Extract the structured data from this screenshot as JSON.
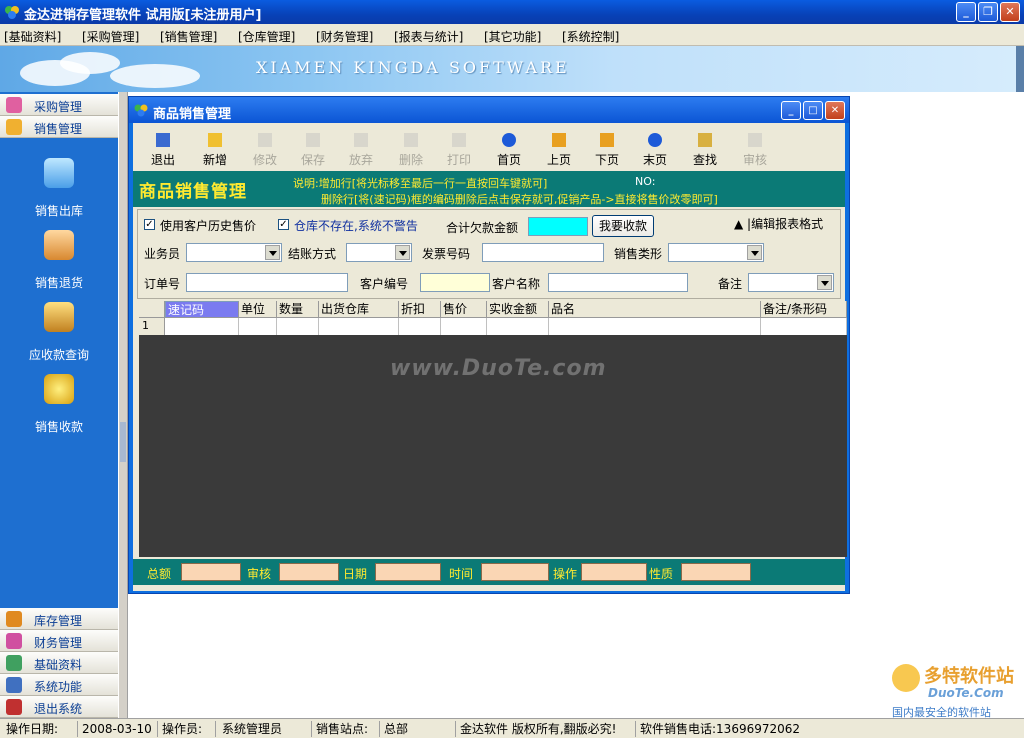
{
  "app": {
    "title": "金达进销存管理软件  试用版[未注册用户]"
  },
  "menu": [
    "[基础资料]",
    "[采购管理]",
    "[销售管理]",
    "[仓库管理]",
    "[财务管理]",
    "[报表与统计]",
    "[其它功能]",
    "[系统控制]"
  ],
  "banner": {
    "slogan": "XIAMEN KINGDA SOFTWARE"
  },
  "leftnav": {
    "top_heads": [
      "采购管理",
      "销售管理"
    ],
    "items": [
      "销售出库",
      "销售退货",
      "应收款查询",
      "销售收款"
    ],
    "bottom_heads": [
      "库存管理",
      "财务管理",
      "基础资料",
      "系统功能",
      "退出系统"
    ]
  },
  "child": {
    "title": "商品销售管理",
    "toolbar": [
      {
        "label": "退出",
        "icon": "exit-icon",
        "enabled": true
      },
      {
        "label": "新增",
        "icon": "folder-icon",
        "enabled": true
      },
      {
        "label": "修改",
        "icon": "edit-icon",
        "enabled": false
      },
      {
        "label": "保存",
        "icon": "save-icon",
        "enabled": false
      },
      {
        "label": "放弃",
        "icon": "undo-icon",
        "enabled": false
      },
      {
        "label": "删除",
        "icon": "delete-icon",
        "enabled": false
      },
      {
        "label": "打印",
        "icon": "print-icon",
        "enabled": false
      },
      {
        "label": "首页",
        "icon": "first-page-icon",
        "enabled": true
      },
      {
        "label": "上页",
        "icon": "prev-page-icon",
        "enabled": true
      },
      {
        "label": "下页",
        "icon": "next-page-icon",
        "enabled": true
      },
      {
        "label": "末页",
        "icon": "last-page-icon",
        "enabled": true
      },
      {
        "label": "查找",
        "icon": "find-icon",
        "enabled": true
      },
      {
        "label": "审核",
        "icon": "audit-icon",
        "enabled": false
      }
    ],
    "heading": "商品销售管理",
    "note1": "说明:增加行[将光标移至最后一行一直按回车键就可]",
    "note2": "删除行[将(速记码)框的编码删除后点击保存就可,促销产品->直接将售价改零即可]",
    "no_label": "NO:",
    "form": {
      "chk_history": "使用客户历史售价",
      "chk_nowarn": "仓库不存在,系统不警告",
      "total_owed": "合计欠款金额",
      "collect_btn": "我要收款",
      "edit_report": "▲ |编辑报表格式",
      "salesman": "业务员",
      "settle": "结账方式",
      "invoice": "发票号码",
      "sale_type": "销售类形",
      "order_no": "订单号",
      "cust_no": "客户编号",
      "cust_name": "客户名称",
      "remark": "备注"
    },
    "grid": {
      "columns": [
        "速记码",
        "单位",
        "数量",
        "出货仓库",
        "折扣",
        "售价",
        "实收金额",
        "品名",
        "备注/条形码"
      ],
      "row_no": "1"
    },
    "footer": [
      "总额",
      "审核",
      "日期",
      "时间",
      "操作",
      "性质"
    ]
  },
  "watermark": "www.DuoTe.com",
  "logo": {
    "line1": "多特软件站",
    "line2": "DuoTe.Com",
    "line3": "国内最安全的软件站"
  },
  "status": {
    "date_label": "操作日期:",
    "date": "2008-03-10",
    "operator_label": "操作员:",
    "operator": "系统管理员",
    "site_label": "销售站点:",
    "site": "总部",
    "copyright": "金达软件 版权所有,翻版必究!",
    "phone": "软件销售电话:13696972062"
  }
}
